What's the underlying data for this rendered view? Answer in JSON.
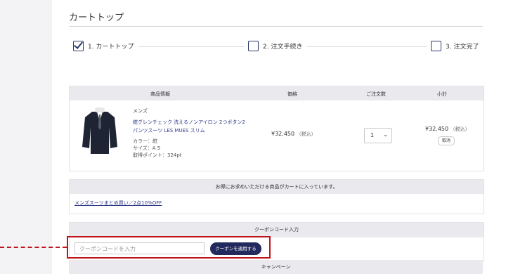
{
  "page": {
    "title": "カートトップ"
  },
  "steps": [
    {
      "label": "1. カートトップ",
      "done": true
    },
    {
      "label": "2. 注文手続き",
      "done": false
    },
    {
      "label": "3. 注文完了",
      "done": false
    }
  ],
  "cart": {
    "headers": {
      "product": "商品情報",
      "price": "価格",
      "qty": "ご注文数",
      "subtotal": "小計"
    },
    "item": {
      "category": "メンズ",
      "name": "紺グレンチェック 洗えるノンアイロン 2つボタン2パンツスーツ LES MUES スリム",
      "color": "カラー：紺",
      "size": "サイズ：A 5",
      "points": "取得ポイント：324pt",
      "price": "¥32,450",
      "tax_note": "（税込）",
      "qty": "1",
      "subtotal": "¥32,450",
      "subtotal_tax": "（税込）",
      "cancel": "取消"
    }
  },
  "recommend": {
    "heading": "お得にお求めいただける商品がカートに入っています。",
    "link": "メンズスーツまとめ買い／2点10%OFF"
  },
  "coupon": {
    "heading": "クーポンコード入力",
    "placeholder": "クーポンコードを入力",
    "button": "クーポンを適用する"
  },
  "campaign": {
    "heading": "キャンペーン"
  },
  "colors": {
    "navy": "#22295c",
    "link": "#2d3a8c",
    "highlight": "#c0141c"
  }
}
